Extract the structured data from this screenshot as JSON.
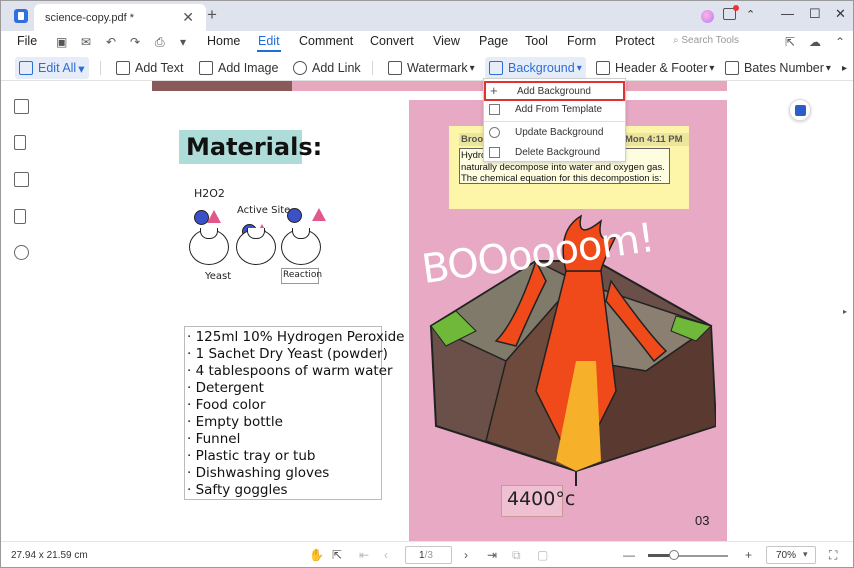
{
  "window": {
    "tab_title": "science-copy.pdf *",
    "tab_close": "✕",
    "tab_add": "+",
    "minimize": "—",
    "maximize": "☐",
    "close": "✕",
    "restore_small": "⌃"
  },
  "menu": {
    "file": "File",
    "items": [
      "Home",
      "Edit",
      "Comment",
      "Convert",
      "View",
      "Page",
      "Tool",
      "Form",
      "Protect"
    ],
    "search_tools": "Search Tools",
    "active": "Edit"
  },
  "toolbar": {
    "edit_all": "Edit All",
    "add_text": "Add Text",
    "add_image": "Add Image",
    "add_link": "Add Link",
    "watermark": "Watermark",
    "background": "Background",
    "header_footer": "Header & Footer",
    "bates_number": "Bates Number",
    "chevron": "▾",
    "more": "▸"
  },
  "background_menu": {
    "items": [
      "Add Background",
      "Add From Template",
      "Update Background",
      "Delete Background"
    ],
    "highlighted": "Add Background"
  },
  "page_content": {
    "materials_title": "Materials:",
    "diagram_labels": {
      "h2o2": "H2O2",
      "active_site": "Active Site",
      "yeast": "Yeast",
      "reaction": "Reaction"
    },
    "list_items": [
      "· 125ml 10% Hydrogen Peroxide",
      "· 1 Sachet Dry Yeast (powder)",
      "· 4 tablespoons of warm water",
      "· Detergent",
      "· Food color",
      "· Empty bottle",
      "· Funnel",
      "· Plastic tray or tub",
      "· Dishwashing gloves",
      "· Safty goggles"
    ],
    "boom": "BOOoooom!",
    "temperature": "4400°c",
    "page_number": "03"
  },
  "sticky_note": {
    "author": "Brook",
    "time": "Mon 4:11 PM",
    "lines": [
      "Hydro                                    stable and",
      "naturally decompose into water and oxygen gas.",
      "The chemical equation for this decompostion is:"
    ]
  },
  "status": {
    "dimensions": "27.94 x 21.59 cm",
    "page_input": "1",
    "page_total": "/3",
    "zoom": "70%",
    "zoom_fraction": 0.33
  }
}
